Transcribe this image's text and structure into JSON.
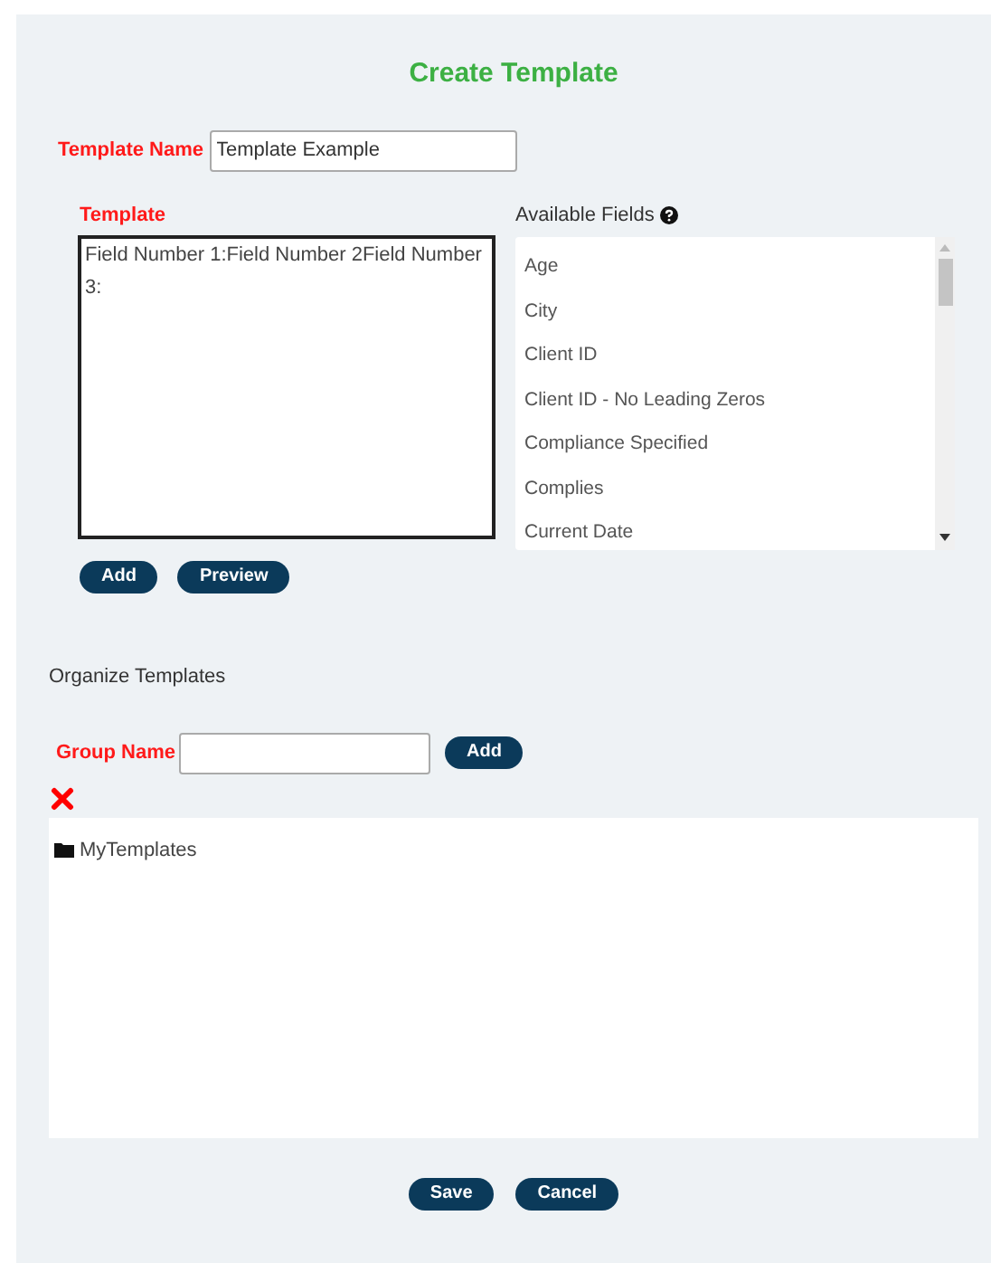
{
  "title": "Create Template",
  "template_name": {
    "label": "Template Name",
    "value": "Template Example"
  },
  "template": {
    "label": "Template",
    "value": "Field Number 1:Field Number 2Field Number 3:"
  },
  "available_fields": {
    "label": "Available Fields",
    "items": [
      "Age",
      "City",
      "Client ID",
      "Client ID - No Leading Zeros",
      "Compliance Specified",
      "Complies",
      "Current Date"
    ]
  },
  "template_buttons": [
    "Add",
    "Preview"
  ],
  "organize": {
    "heading": "Organize Templates",
    "group_label": "Group Name",
    "add_button": "Add",
    "tree": [
      {
        "label": "MyTemplates"
      }
    ]
  },
  "footer_buttons": [
    "Save",
    "Cancel"
  ]
}
